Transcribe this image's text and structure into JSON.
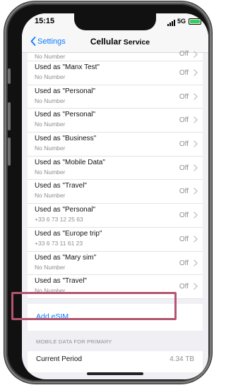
{
  "status_bar": {
    "time": "15:15",
    "network": "5G"
  },
  "nav": {
    "back_label": "Settings",
    "title_bold": "Cellular",
    "title_rest": " Service"
  },
  "lines": [
    {
      "name": "",
      "number": "No Number",
      "value": "Off"
    },
    {
      "name": "Used as \"Manx Test\"",
      "number": "No Number",
      "value": "Off"
    },
    {
      "name": "Used as \"Personal\"",
      "number": "No Number",
      "value": "Off"
    },
    {
      "name": "Used as \"Personal\"",
      "number": "No Number",
      "value": "Off"
    },
    {
      "name": "Used as \"Business\"",
      "number": "No Number",
      "value": "Off"
    },
    {
      "name": "Used as \"Mobile Data\"",
      "number": "No Number",
      "value": "Off"
    },
    {
      "name": "Used as \"Travel\"",
      "number": "No Number",
      "value": "Off"
    },
    {
      "name": "Used as \"Personal\"",
      "number": "+33 6 73 12 25 63",
      "value": "Off"
    },
    {
      "name": "Used as \"Europe trip\"",
      "number": "+33 6 73 11 61 23",
      "value": "Off"
    },
    {
      "name": "Used as \"Mary sim\"",
      "number": "No Number",
      "value": "Off"
    },
    {
      "name": "Used as \"Travel\"",
      "number": "No Number",
      "value": "Off"
    }
  ],
  "add_esim": {
    "label": "Add eSIM"
  },
  "mobile_data": {
    "section_header": "MOBILE DATA FOR PRIMARY",
    "current_period_label": "Current Period",
    "current_period_value": "4.34 TB"
  },
  "colors": {
    "accent": "#0a7aff",
    "highlight": "#b4546f",
    "battery": "#2fd158"
  }
}
